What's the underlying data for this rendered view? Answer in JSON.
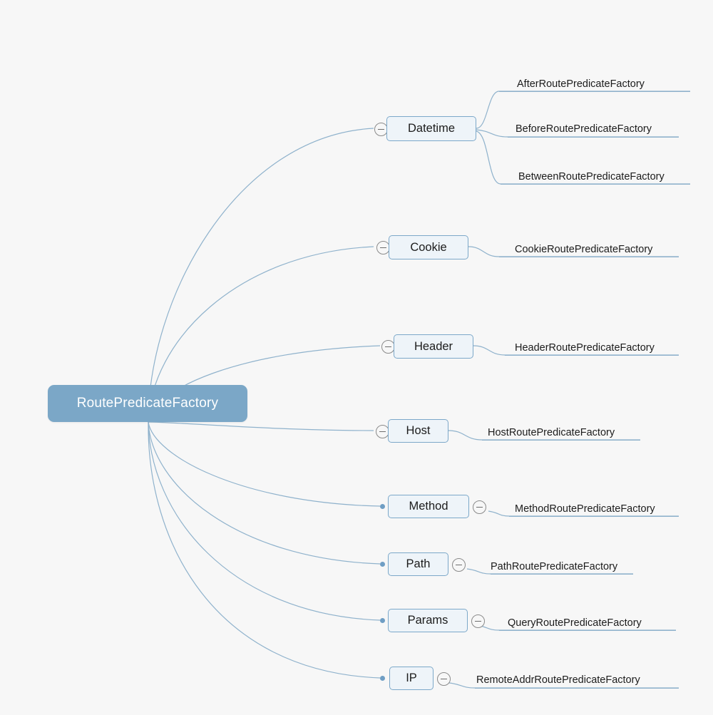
{
  "diagram": {
    "type": "mind-map",
    "background_color": "#f7f7f7",
    "root": {
      "label": "RoutePredicateFactory",
      "fill_color": "#7BA7C7",
      "text_color": "#ffffff"
    },
    "branch_style": {
      "fill_color": "#eef4f9",
      "border_color": "#7ca8c9",
      "text_color": "#1c1c1c",
      "edge_color": "#8fb2cc"
    },
    "branches": [
      {
        "label": "Datetime",
        "toggle_icon": "minus-circle-icon",
        "toggle_side": "left",
        "children": [
          {
            "label": "AfterRoutePredicateFactory"
          },
          {
            "label": "BeforeRoutePredicateFactory"
          },
          {
            "label": "BetweenRoutePredicateFactory"
          }
        ]
      },
      {
        "label": "Cookie",
        "toggle_icon": "minus-circle-icon",
        "toggle_side": "left",
        "children": [
          {
            "label": "CookieRoutePredicateFactory"
          }
        ]
      },
      {
        "label": "Header",
        "toggle_icon": "minus-circle-icon",
        "toggle_side": "left",
        "children": [
          {
            "label": "HeaderRoutePredicateFactory"
          }
        ]
      },
      {
        "label": "Host",
        "toggle_icon": "minus-circle-icon",
        "toggle_side": "left",
        "children": [
          {
            "label": "HostRoutePredicateFactory"
          }
        ]
      },
      {
        "label": "Method",
        "toggle_icon": "minus-circle-icon",
        "toggle_side": "right",
        "bullet_icon": "dot-icon",
        "children": [
          {
            "label": "MethodRoutePredicateFactory"
          }
        ]
      },
      {
        "label": "Path",
        "toggle_icon": "minus-circle-icon",
        "toggle_side": "right",
        "bullet_icon": "dot-icon",
        "children": [
          {
            "label": "PathRoutePredicateFactory"
          }
        ]
      },
      {
        "label": "Params",
        "toggle_icon": "minus-circle-icon",
        "toggle_side": "right",
        "bullet_icon": "dot-icon",
        "children": [
          {
            "label": "QueryRoutePredicateFactory"
          }
        ]
      },
      {
        "label": "IP",
        "toggle_icon": "minus-circle-icon",
        "toggle_side": "right",
        "bullet_icon": "dot-icon",
        "children": [
          {
            "label": "RemoteAddrRoutePredicateFactory"
          }
        ]
      }
    ]
  }
}
